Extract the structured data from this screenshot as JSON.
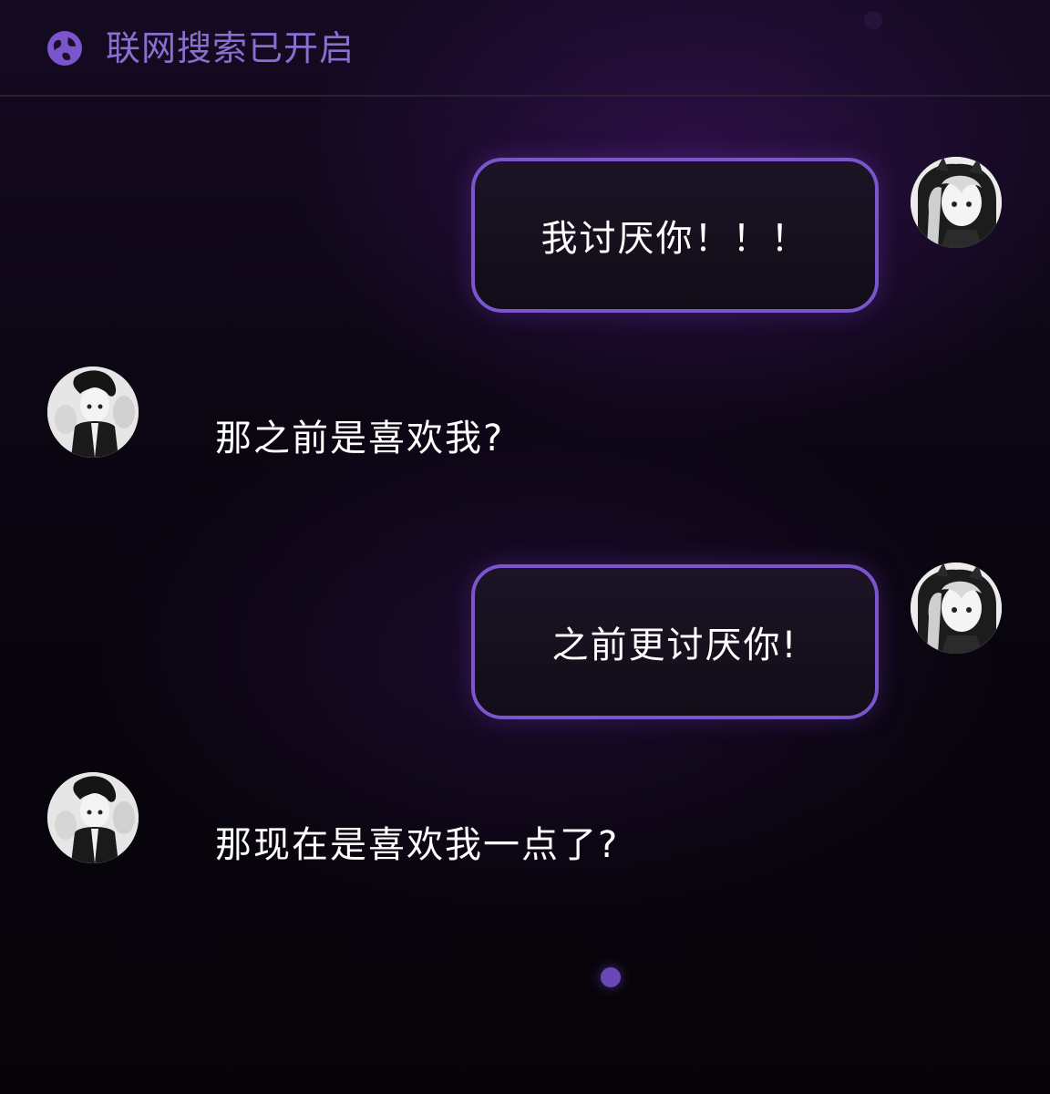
{
  "header": {
    "icon": "globe-icon",
    "status_text": "联网搜索已开启"
  },
  "messages": [
    {
      "role": "user",
      "text": "我讨厌你！！！",
      "avatar": "user-avatar"
    },
    {
      "role": "assistant",
      "text": "那之前是喜欢我?",
      "avatar": "assistant-avatar"
    },
    {
      "role": "user",
      "text": "之前更讨厌你!",
      "avatar": "user-avatar"
    },
    {
      "role": "assistant",
      "text": "那现在是喜欢我一点了?",
      "avatar": "assistant-avatar"
    }
  ],
  "indicator": {
    "icon": "typing-dot-icon",
    "color": "#6a48b8"
  },
  "colors": {
    "accent": "#7a55cc",
    "header_text": "#8a6fd0",
    "background": "#0a0510"
  }
}
